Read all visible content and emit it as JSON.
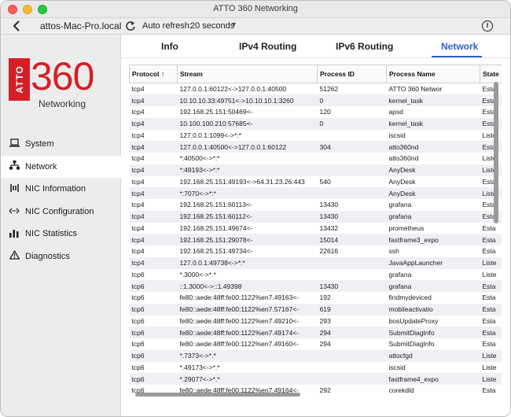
{
  "window": {
    "title": "ATTO 360 Networking"
  },
  "toolbar": {
    "host": "attos-Mac-Pro.local",
    "auto_refresh_label": "Auto refresh:",
    "auto_refresh_value": "20 seconds",
    "icons": {
      "back": "chevron-left-icon",
      "refresh": "refresh-icon",
      "info": "info-icon",
      "dropdown": "chevron-down-icon"
    }
  },
  "logo": {
    "atto": "ATTO",
    "number": "360",
    "subtitle": "Networking"
  },
  "sidebar": {
    "items": [
      {
        "label": "System",
        "icon": "laptop-icon",
        "active": false
      },
      {
        "label": "Network",
        "icon": "network-tree-icon",
        "active": true
      },
      {
        "label": "NIC Information",
        "icon": "nic-icon",
        "active": false
      },
      {
        "label": "NIC Configuration",
        "icon": "arrows-icon",
        "active": false
      },
      {
        "label": "NIC Statistics",
        "icon": "bar-chart-icon",
        "active": false
      },
      {
        "label": "Diagnostics",
        "icon": "warning-icon",
        "active": false
      }
    ]
  },
  "tabs": [
    {
      "label": "Info",
      "active": false
    },
    {
      "label": "IPv4 Routing",
      "active": false
    },
    {
      "label": "IPv6 Routing",
      "active": false
    },
    {
      "label": "Network",
      "active": true
    }
  ],
  "table": {
    "columns": [
      "Protocol ↑",
      "Stream",
      "Process ID",
      "Process Name",
      "State"
    ],
    "rows": [
      [
        "tcp4",
        "127.0.0.1:60122<->127.0.0.1:40500",
        "51262",
        "ATTO 360 Networ",
        "Esta"
      ],
      [
        "tcp4",
        "10.10.10.33:49751<->10.10.10.1:3260",
        "0",
        "kernel_task",
        "Esta"
      ],
      [
        "tcp4",
        "192.168.25.151:50469<-",
        "120",
        "apsd",
        "Esta"
      ],
      [
        "tcp4",
        "10.100.100.210:57685<-",
        "0",
        "kernel_task",
        "Esta"
      ],
      [
        "tcp4",
        "127.0.0.1:1099<->*:*",
        "",
        "iscsid",
        "Liste"
      ],
      [
        "tcp4",
        "127.0.0.1:40500<->127.0.0.1:60122",
        "304",
        "atto360nd",
        "Esta"
      ],
      [
        "tcp4",
        "*:40500<->*:*",
        "",
        "atto360nd",
        "Liste"
      ],
      [
        "tcp4",
        "*:49193<->*:*",
        "",
        "AnyDesk",
        "Liste"
      ],
      [
        "tcp4",
        "192.168.25.151:49193<->64.31.23.26:443",
        "540",
        "AnyDesk",
        "Esta"
      ],
      [
        "tcp4",
        "*:7070<->*:*",
        "",
        "AnyDesk",
        "Liste"
      ],
      [
        "tcp4",
        "192.168.25.151:60113<-",
        "13430",
        "grafana",
        "Esta"
      ],
      [
        "tcp4",
        "192.168.25.151:60112<-",
        "13430",
        "grafana",
        "Esta"
      ],
      [
        "tcp4",
        "192.168.25.151:49674<-",
        "13432",
        "prometheus",
        "Esta"
      ],
      [
        "tcp4",
        "192.168.25.151:29078<-",
        "15014",
        "fastframe3_expo",
        "Esta"
      ],
      [
        "tcp4",
        "192.168.25.151:49734<-",
        "22616",
        "ssh",
        "Esta"
      ],
      [
        "tcp4",
        "127.0.0.1:49738<->*:*",
        "",
        "JavaAppLauncher",
        "Liste"
      ],
      [
        "tcp6",
        "*.3000<->*.*",
        "",
        "grafana",
        "Liste"
      ],
      [
        "tcp6",
        "::1.3000<->::1.49398",
        "13430",
        "grafana",
        "Esta"
      ],
      [
        "tcp6",
        "fe80::aede:48ff:fe00:1122%en7.49163<-",
        "192",
        "findmydeviced",
        "Esta"
      ],
      [
        "tcp6",
        "fe80::aede:48ff:fe00:1122%en7.57167<-",
        "619",
        "mobileactivatio",
        "Esta"
      ],
      [
        "tcp6",
        "fe80::aede:48ff:fe00:1122%en7.49210<-",
        "293",
        "bosUpdateProxy",
        "Esta"
      ],
      [
        "tcp6",
        "fe80::aede:48ff:fe00:1122%en7.49174<-",
        "294",
        "SubmitDiagInfo",
        "Esta"
      ],
      [
        "tcp6",
        "fe80::aede:48ff:fe00:1122%en7.49160<-",
        "294",
        "SubmitDiagInfo",
        "Esta"
      ],
      [
        "tcp6",
        "*.7373<->*.*",
        "",
        "attocfgd",
        "Liste"
      ],
      [
        "tcp6",
        "*.49173<->*.*",
        "",
        "iscsid",
        "Liste"
      ],
      [
        "tcp6",
        "*.29077<->*.*",
        "",
        "fastframe4_expo",
        "Liste"
      ],
      [
        "tcp6",
        "fe80::aede:48ff:fe00:1122%en7.49164<-",
        "292",
        "corekdld",
        "Esta"
      ]
    ]
  },
  "colors": {
    "brand_red": "#d51f26",
    "accent_blue": "#2a62c9",
    "row_alt": "#eef0f4"
  }
}
